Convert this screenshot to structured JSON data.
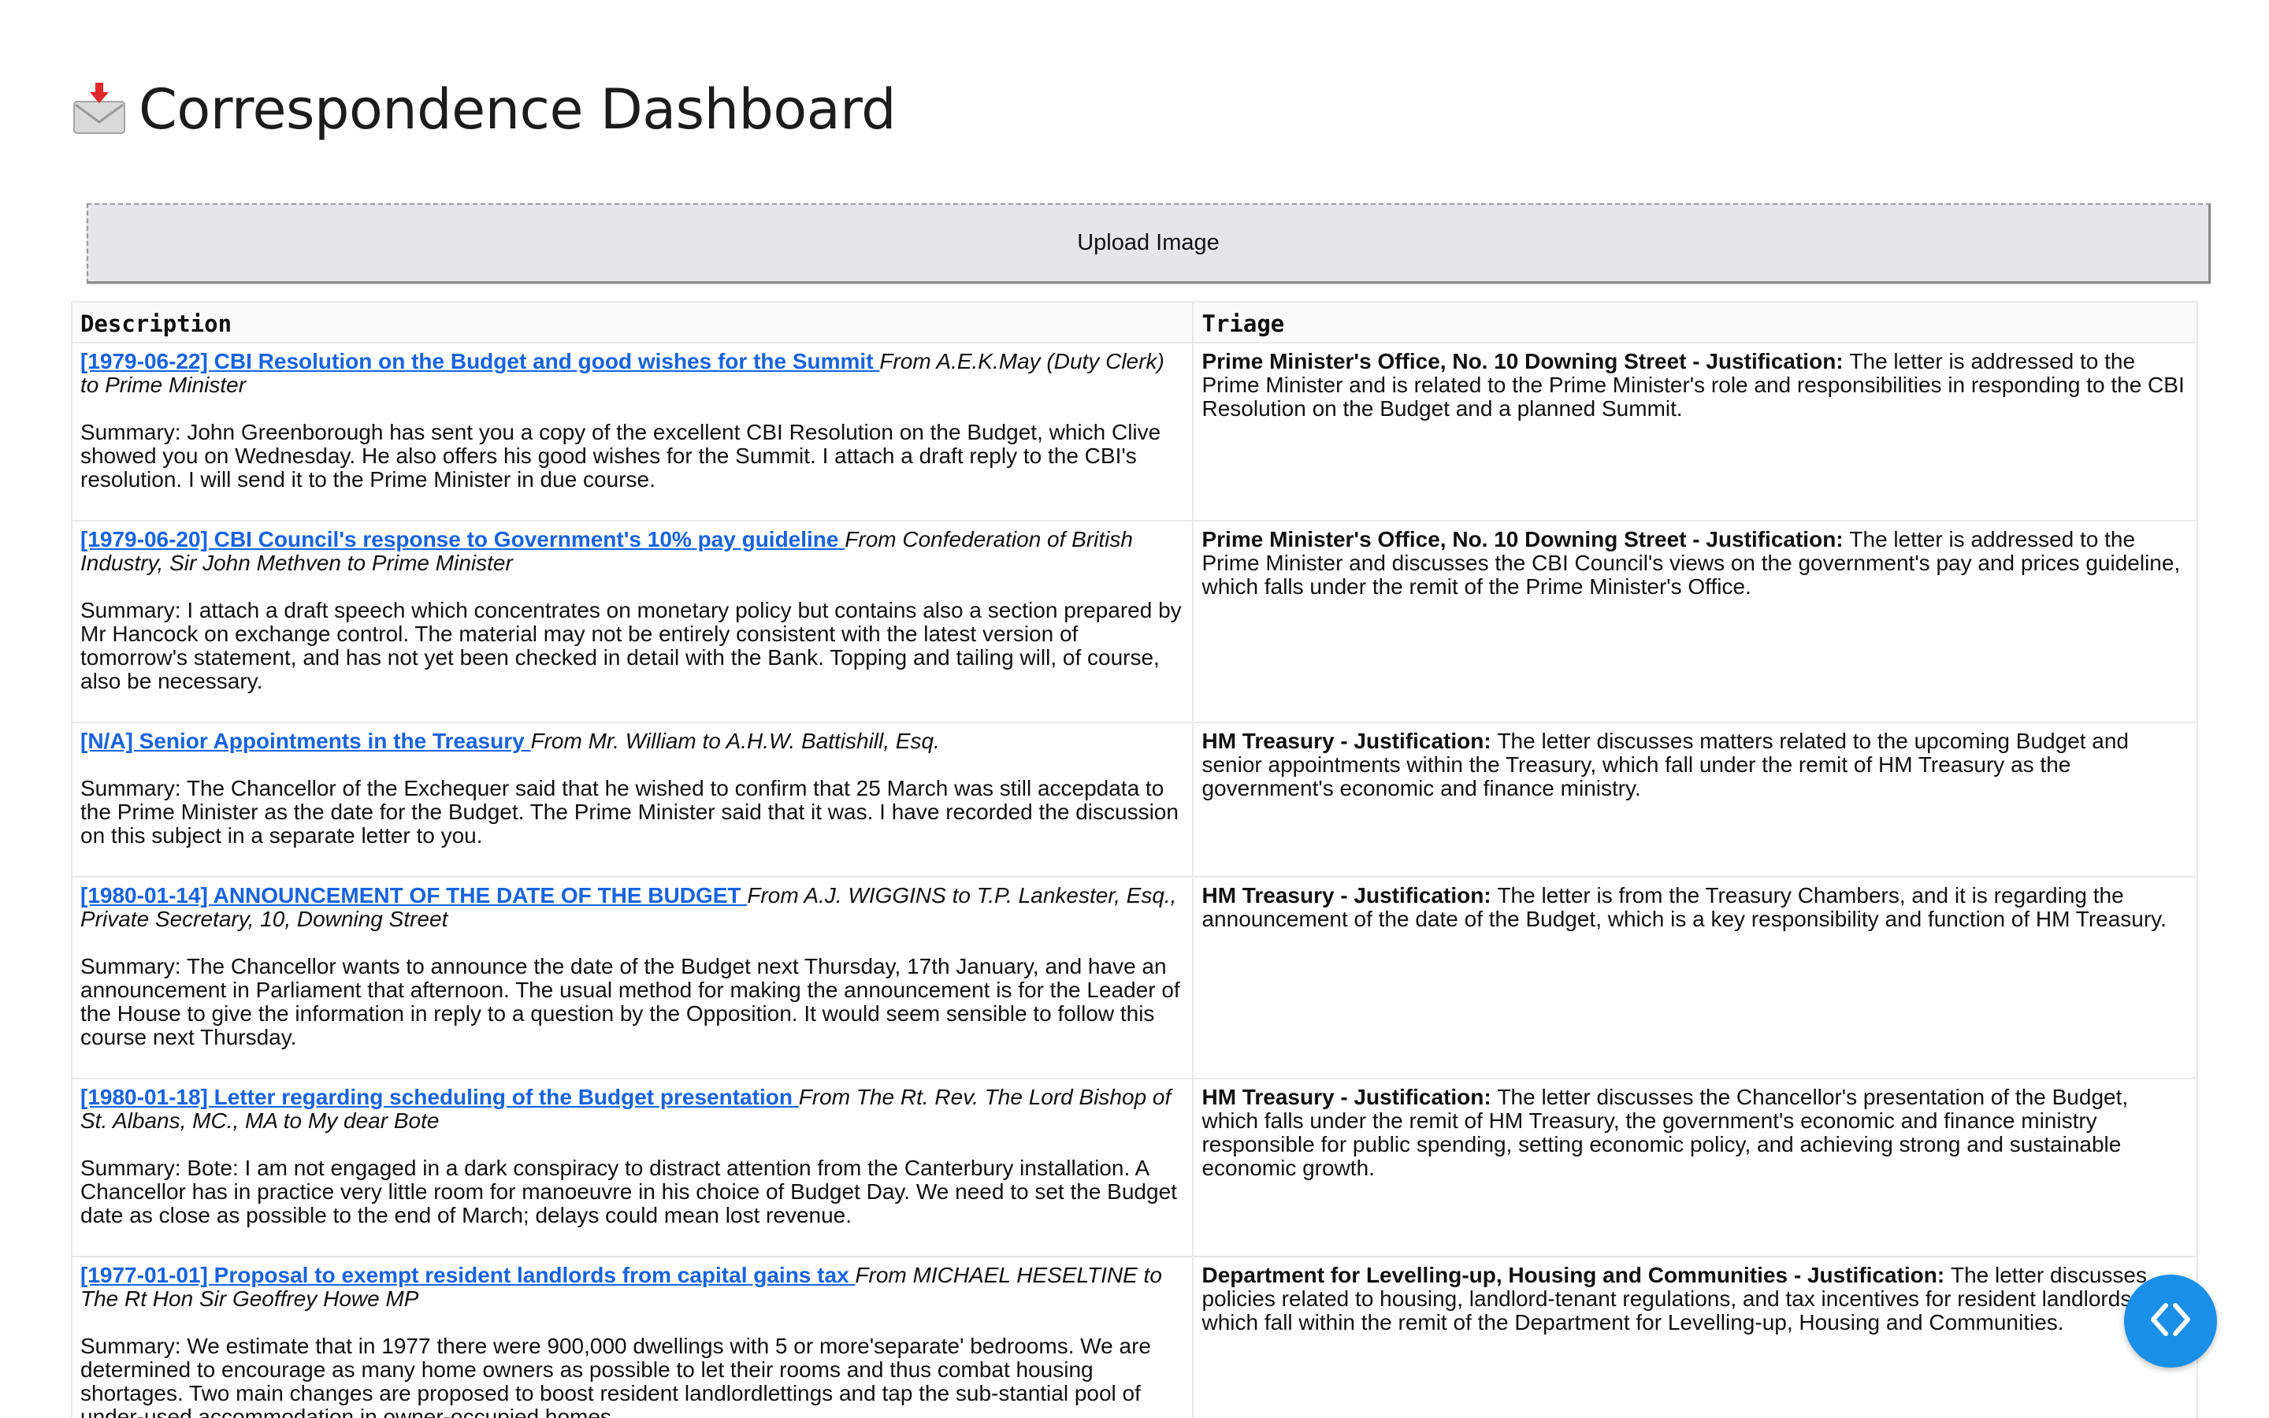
{
  "header": {
    "icon": "inbox-tray-envelope-icon",
    "title": "Correspondence Dashboard"
  },
  "upload": {
    "label": "Upload Image"
  },
  "table": {
    "columns": [
      "Description",
      "Triage"
    ],
    "rows": [
      {
        "title": "[1979-06-22] CBI Resolution on the Budget and good wishes for the Summit",
        "from": "From A.E.K.May (Duty Clerk) to Prime Minister",
        "summary": "Summary: John Greenborough has sent you a copy of the excellent CBI Resolution on the Budget, which Clive showed you on Wednesday. He also offers his good wishes for the Summit. I attach a draft reply to the CBI's resolution. I will send it to the Prime Minister in due course.",
        "department": "Prime Minister's Office, No. 10 Downing Street - Justification:",
        "justification": "The letter is addressed to the Prime Minister and is related to the Prime Minister's role and responsibilities in responding to the CBI Resolution on the Budget and a planned Summit."
      },
      {
        "title": "[1979-06-20] CBI Council's response to Government's 10% pay guideline",
        "from": "From Confederation of British Industry, Sir John Methven to Prime Minister",
        "summary": "Summary: I attach a draft speech which concentrates on monetary policy but contains also a section prepared by Mr Hancock on exchange control. The material may not be entirely consistent with the latest version of tomorrow's statement, and has not yet been checked in detail with the Bank. Topping and tailing will, of course, also be necessary.",
        "department": "Prime Minister's Office, No. 10 Downing Street - Justification:",
        "justification": "The letter is addressed to the Prime Minister and discusses the CBI Council's views on the government's pay and prices guideline, which falls under the remit of the Prime Minister's Office."
      },
      {
        "title": "[N/A] Senior Appointments in the Treasury",
        "from": "From Mr. William to A.H.W. Battishill, Esq.",
        "summary": "Summary: The Chancellor of the Exchequer said that he wished to confirm that 25 March was still accepdata to the Prime Minister as the date for the Budget. The Prime Minister said that it was. I have recorded the discussion on this subject in a separate letter to you.",
        "department": "HM Treasury - Justification:",
        "justification": "The letter discusses matters related to the upcoming Budget and senior appointments within the Treasury, which fall under the remit of HM Treasury as the government's economic and finance ministry."
      },
      {
        "title": "[1980-01-14] ANNOUNCEMENT OF THE DATE OF THE BUDGET",
        "from": "From A.J. WIGGINS to T.P. Lankester, Esq., Private Secretary, 10, Downing Street",
        "summary": "Summary: The Chancellor wants to announce the date of the Budget next Thursday, 17th January, and have an announcement in Parliament that afternoon. The usual method for making the announcement is for the Leader of the House to give the information in reply to a question by the Opposition. It would seem sensible to follow this course next Thursday.",
        "department": "HM Treasury - Justification:",
        "justification": "The letter is from the Treasury Chambers, and it is regarding the announcement of the date of the Budget, which is a key responsibility and function of HM Treasury."
      },
      {
        "title": "[1980-01-18] Letter regarding scheduling of the Budget presentation",
        "from": "From The Rt. Rev. The Lord Bishop of St. Albans, MC., MA to My dear Bote",
        "summary": "Summary: Bote: I am not engaged in a dark conspiracy to distract attention from the Canterbury installation. A Chancellor has in practice very little room for manoeuvre in his choice of Budget Day. We need to set the Budget date as close as possible to the end of March; delays could mean lost revenue.",
        "department": "HM Treasury - Justification:",
        "justification": "The letter discusses the Chancellor's presentation of the Budget, which falls under the remit of HM Treasury, the government's economic and finance ministry responsible for public spending, setting economic policy, and achieving strong and sustainable economic growth."
      },
      {
        "title": "[1977-01-01] Proposal to exempt resident landlords from capital gains tax",
        "from": "From MICHAEL HESELTINE to The Rt Hon Sir Geoffrey Howe MP",
        "summary": "Summary: We estimate that in 1977 there were 900,000 dwellings with 5 or more'separate' bedrooms. We are determined to encourage as many home owners as possible to let their rooms and thus combat housing shortages. Two main changes are proposed to boost resident landlordlettings and tap the sub-stantial pool of under-used accommodation in owner-occupied homes.",
        "department": "Department for Levelling-up, Housing and Communities - Justification:",
        "justification": "The letter discusses policies related to housing, landlord-tenant regulations, and tax incentives for resident landlords, which fall within the remit of the Department for Levelling-up, Housing and Communities."
      }
    ]
  },
  "fab": {
    "icon": "code-brackets-icon",
    "color": "#1a8fe8"
  }
}
